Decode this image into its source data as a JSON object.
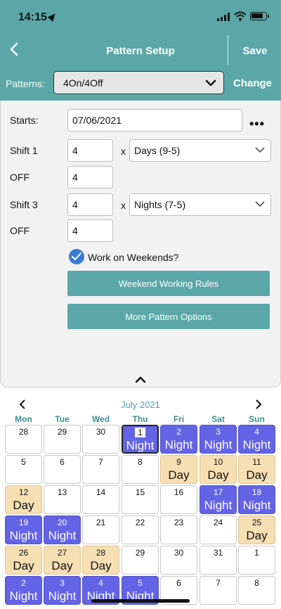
{
  "status": {
    "time": "14:15"
  },
  "header": {
    "title": "Pattern Setup",
    "save_label": "Save"
  },
  "patterns": {
    "label": "Patterns:",
    "value": "4On/4Off",
    "change_label": "Change"
  },
  "form": {
    "starts_label": "Starts:",
    "starts_value": "07/06/2021",
    "more_label": "•••",
    "shift1_label": "Shift 1",
    "shift1_days": "4",
    "shift1_type": "Days (9-5)",
    "off1_label": "OFF",
    "off1_days": "4",
    "shift3_label": "Shift 3",
    "shift3_days": "4",
    "shift3_type": "Nights (7-5)",
    "off2_label": "OFF",
    "off2_days": "4",
    "times_label": "x",
    "weekends_label": "Work on Weekends?",
    "weekends_checked": true,
    "weekend_rules_button": "Weekend Working Rules",
    "more_options_button": "More Pattern Options"
  },
  "calendar": {
    "month": "July 2021",
    "days_of_week": [
      "Mon",
      "Tue",
      "Wed",
      "Thu",
      "Fri",
      "Sat",
      "Sun"
    ],
    "colors": {
      "night": "#6363e6",
      "day": "#f7dfb4",
      "accent": "#5ba7a8"
    },
    "weeks": [
      [
        {
          "d": "28",
          "s": ""
        },
        {
          "d": "29",
          "s": ""
        },
        {
          "d": "30",
          "s": ""
        },
        {
          "d": "1",
          "s": "Night",
          "today": true
        },
        {
          "d": "2",
          "s": "Night"
        },
        {
          "d": "3",
          "s": "Night"
        },
        {
          "d": "4",
          "s": "Night"
        }
      ],
      [
        {
          "d": "5",
          "s": ""
        },
        {
          "d": "6",
          "s": ""
        },
        {
          "d": "7",
          "s": ""
        },
        {
          "d": "8",
          "s": ""
        },
        {
          "d": "9",
          "s": "Day"
        },
        {
          "d": "10",
          "s": "Day"
        },
        {
          "d": "11",
          "s": "Day"
        }
      ],
      [
        {
          "d": "12",
          "s": "Day"
        },
        {
          "d": "13",
          "s": ""
        },
        {
          "d": "14",
          "s": ""
        },
        {
          "d": "15",
          "s": ""
        },
        {
          "d": "16",
          "s": ""
        },
        {
          "d": "17",
          "s": "Night"
        },
        {
          "d": "18",
          "s": "Night"
        }
      ],
      [
        {
          "d": "19",
          "s": "Night"
        },
        {
          "d": "20",
          "s": "Night"
        },
        {
          "d": "21",
          "s": ""
        },
        {
          "d": "22",
          "s": ""
        },
        {
          "d": "23",
          "s": ""
        },
        {
          "d": "24",
          "s": ""
        },
        {
          "d": "25",
          "s": "Day"
        }
      ],
      [
        {
          "d": "26",
          "s": "Day"
        },
        {
          "d": "27",
          "s": "Day"
        },
        {
          "d": "28",
          "s": "Day"
        },
        {
          "d": "29",
          "s": ""
        },
        {
          "d": "30",
          "s": ""
        },
        {
          "d": "31",
          "s": ""
        },
        {
          "d": "1",
          "s": ""
        }
      ],
      [
        {
          "d": "2",
          "s": "Night"
        },
        {
          "d": "3",
          "s": "Night"
        },
        {
          "d": "4",
          "s": "Night"
        },
        {
          "d": "5",
          "s": "Night"
        },
        {
          "d": "6",
          "s": ""
        },
        {
          "d": "7",
          "s": ""
        },
        {
          "d": "8",
          "s": ""
        }
      ]
    ]
  }
}
